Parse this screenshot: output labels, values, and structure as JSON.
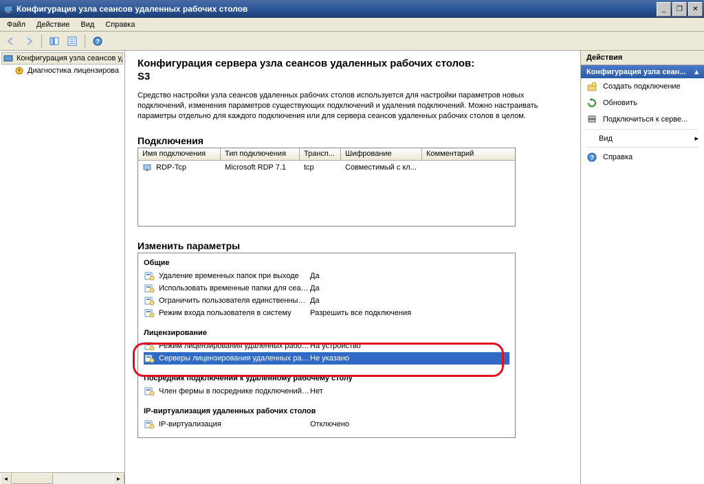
{
  "window": {
    "title": "Конфигурация узла сеансов удаленных рабочих столов"
  },
  "menu": {
    "file": "Файл",
    "action": "Действие",
    "view": "Вид",
    "help": "Справка"
  },
  "tree": {
    "root": "Конфигурация узла сеансов уд",
    "child1": "Диагностика лицензирова"
  },
  "content": {
    "title": "Конфигурация сервера узла сеансов удаленных рабочих столов:",
    "server": "S3",
    "description": "Средство настройки узла сеансов удаленных рабочих столов используется для настройки параметров новых подключений, изменения параметров существующих подключений и удаления подключений. Можно настраивать параметры отдельно для каждого подключения или для сервера сеансов удаленных рабочих столов в целом.",
    "connections_heading": "Подключения",
    "conn_cols": {
      "name": "Имя подключения",
      "type": "Тип подключения",
      "transport": "Трансп...",
      "encryption": "Шифрование",
      "comment": "Комментарий"
    },
    "conn_row": {
      "name": "RDP-Tcp",
      "type": "Microsoft RDP 7.1",
      "transport": "tcp",
      "encryption": "Совместимый с кл...",
      "comment": ""
    },
    "edit_heading": "Изменить параметры",
    "general_heading": "Общие",
    "general": [
      {
        "label": "Удаление временных папок при выходе",
        "value": "Да"
      },
      {
        "label": "Использовать временные папки для сеан...",
        "value": "Да"
      },
      {
        "label": "Ограничить пользователя единственным ...",
        "value": "Да"
      },
      {
        "label": "Режим входа пользователя в систему",
        "value": "Разрешить все подключения"
      }
    ],
    "licensing_heading": "Лицензирование",
    "licensing": [
      {
        "label": "Режим лицензирования удаленных рабочи...",
        "value": "На устройство"
      },
      {
        "label": "Серверы лицензирования удаленных рабо...",
        "value": "Не указано"
      }
    ],
    "broker_heading": "Посредник подключений к удаленному рабочему столу",
    "broker": [
      {
        "label": "Член фермы в посреднике подключений к...",
        "value": "Нет"
      }
    ],
    "ipvirt_heading": "IP-виртуализация удаленных рабочих столов",
    "ipvirt": [
      {
        "label": "IP-виртуализация",
        "value": "Отключено"
      }
    ]
  },
  "actions": {
    "header": "Действия",
    "subheader": "Конфигурация узла сеан...",
    "create": "Создать подключение",
    "refresh": "Обновить",
    "connect": "Подключиться к серве...",
    "view": "Вид",
    "help": "Справка"
  }
}
